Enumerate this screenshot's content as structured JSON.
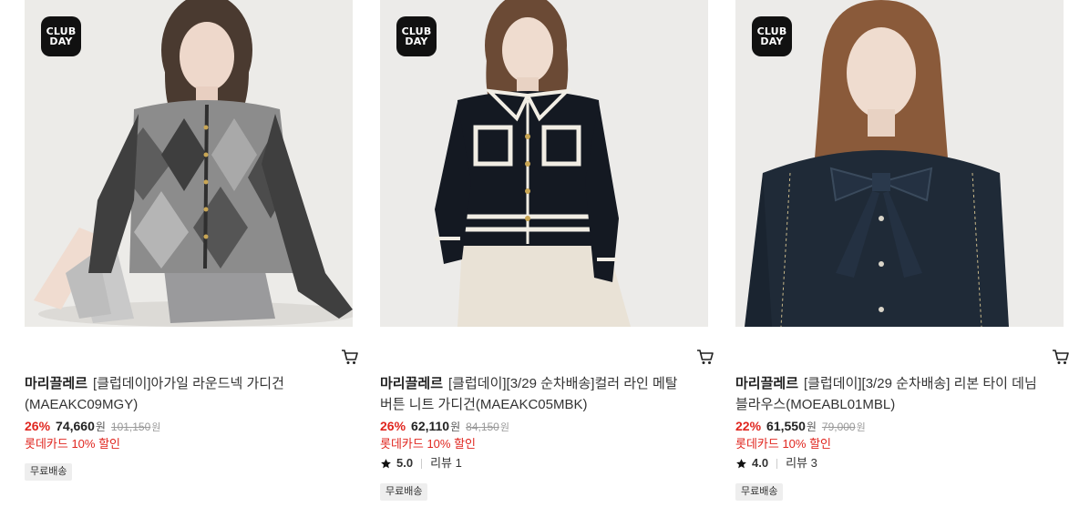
{
  "products": [
    {
      "badge": [
        "CLUB",
        "DAY"
      ],
      "brand": "마리끌레르",
      "name": "[클럽데이]아가일 라운드넥 가디건(MAEAKC09MGY)",
      "discount": "26%",
      "price": "74,660",
      "currency": "원",
      "original_price": "101,150",
      "card_promo": "롯데카드 10% 할인",
      "shipping": "무료배송"
    },
    {
      "badge": [
        "CLUB",
        "DAY"
      ],
      "brand": "마리끌레르",
      "name": "[클럽데이][3/29 순차배송]컬러 라인 메탈 버튼 니트 가디건(MAEAKC05MBK)",
      "discount": "26%",
      "price": "62,110",
      "currency": "원",
      "original_price": "84,150",
      "card_promo": "롯데카드 10% 할인",
      "rating": "5.0",
      "review_label": "리뷰",
      "review_count": "1",
      "shipping": "무료배송"
    },
    {
      "badge": [
        "CLUB",
        "DAY"
      ],
      "brand": "마리끌레르",
      "name": "[클럽데이][3/29 순차배송] 리본 타이 데님 블라우스(MOEABL01MBL)",
      "discount": "22%",
      "price": "61,550",
      "currency": "원",
      "original_price": "79,000",
      "card_promo": "롯데카드 10% 할인",
      "rating": "4.0",
      "review_label": "리뷰",
      "review_count": "3",
      "shipping": "무료배송"
    }
  ],
  "colors": {
    "discount": "#e0261f",
    "badge_bg": "#111111",
    "shipping_bg": "#eeeeee"
  },
  "icons": {
    "cart": "cart-icon",
    "star": "star-icon",
    "badge": "club-day-badge"
  }
}
